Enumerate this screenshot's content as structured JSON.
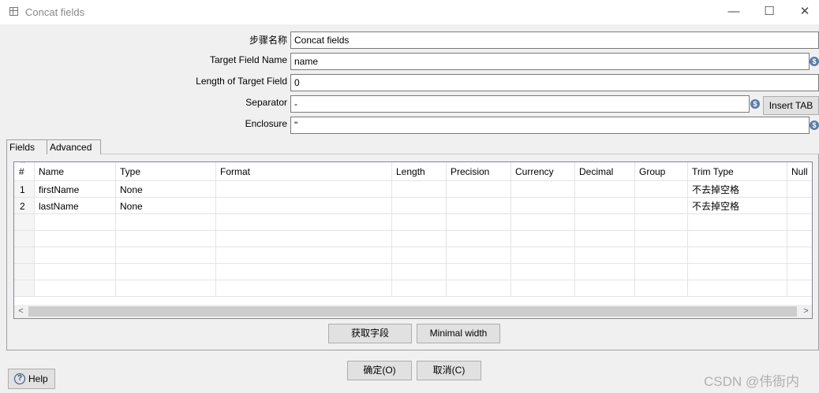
{
  "window": {
    "title": "Concat fields",
    "minimize_glyph": "—",
    "maximize_glyph": "☐",
    "close_glyph": "✕"
  },
  "form": {
    "step_name_label": "步骤名称",
    "step_name_value": "Concat fields",
    "target_field_label": "Target Field Name",
    "target_field_value": "name",
    "length_label": "Length of Target Field",
    "length_value": "0",
    "separator_label": "Separator",
    "separator_value": "-",
    "insert_tab_label": "Insert TAB",
    "enclosure_label": "Enclosure",
    "enclosure_value": "\""
  },
  "variable_icon_glyph": "$",
  "tabs": [
    {
      "label": "Fields",
      "active": true
    },
    {
      "label": "Advanced",
      "active": false
    }
  ],
  "table": {
    "columns": [
      "#",
      "Name",
      "Type",
      "Format",
      "Length",
      "Precision",
      "Currency",
      "Decimal",
      "Group",
      "Trim Type",
      "Null"
    ],
    "rows": [
      [
        "1",
        "firstName",
        "None",
        "",
        "",
        "",
        "",
        "",
        "",
        "不去掉空格",
        ""
      ],
      [
        "2",
        "lastName",
        "None",
        "",
        "",
        "",
        "",
        "",
        "",
        "不去掉空格",
        ""
      ]
    ],
    "sort_glyph": "^"
  },
  "scroll": {
    "left_glyph": "<",
    "right_glyph": ">"
  },
  "buttons": {
    "get_fields": "获取字段",
    "minimal_width": "Minimal width",
    "ok": "确定(O)",
    "cancel": "取消(C)",
    "help": "Help",
    "help_glyph": "?"
  },
  "watermark": "CSDN @伟衙内"
}
